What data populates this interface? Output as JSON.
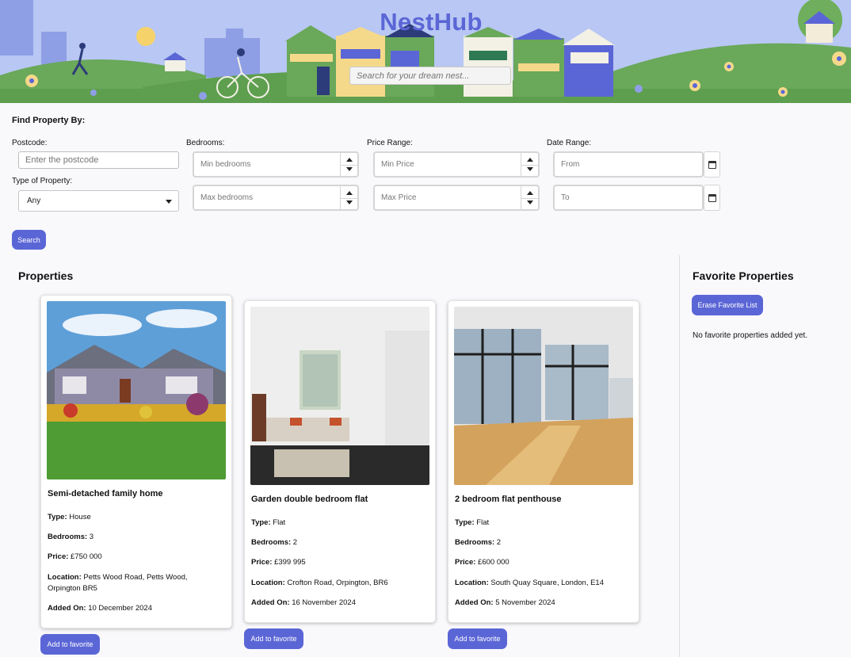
{
  "header": {
    "brand": "NestHub",
    "search_placeholder": "Search for your dream nest..."
  },
  "filters": {
    "title": "Find Property By:",
    "postcode": {
      "label": "Postcode:",
      "placeholder": "Enter the postcode"
    },
    "type": {
      "label": "Type of Property:",
      "selected": "Any"
    },
    "bedrooms": {
      "label": "Bedrooms:",
      "min_placeholder": "Min bedrooms",
      "max_placeholder": "Max bedrooms"
    },
    "price": {
      "label": "Price Range:",
      "min_placeholder": "Min Price",
      "max_placeholder": "Max Price"
    },
    "date": {
      "label": "Date Range:",
      "from_placeholder": "From",
      "to_placeholder": "To"
    },
    "search_label": "Search"
  },
  "properties": {
    "title": "Properties",
    "labels": {
      "type": "Type:",
      "bedrooms": "Bedrooms:",
      "price": "Price:",
      "location": "Location:",
      "added": "Added On:"
    },
    "add_favorite_label": "Add to favorite",
    "items": [
      {
        "title": "Semi-detached family home",
        "type": "House",
        "bedrooms": "3",
        "price": "£750 000",
        "location": "Petts Wood Road, Petts Wood, Orpington BR5",
        "added": "10 December 2024"
      },
      {
        "title": "Garden double bedroom flat",
        "type": "Flat",
        "bedrooms": "2",
        "price": "£399 995",
        "location": "Crofton Road, Orpington, BR6",
        "added": "16 November 2024"
      },
      {
        "title": "2 bedroom flat penthouse",
        "type": "Flat",
        "bedrooms": "2",
        "price": "£600 000",
        "location": "South Quay Square, London, E14",
        "added": "5 November 2024"
      }
    ]
  },
  "favorites": {
    "title": "Favorite Properties",
    "erase_label": "Erase Favorite List",
    "empty_text": "No favorite properties added yet."
  },
  "theme": {
    "accent": "#5b66d6",
    "banner_sky": "#b9c8f4",
    "banner_grass": "#5e9f4f"
  },
  "icons": [
    "dropdown-caret-icon",
    "spinner-up-icon",
    "spinner-down-icon",
    "calendar-icon"
  ]
}
